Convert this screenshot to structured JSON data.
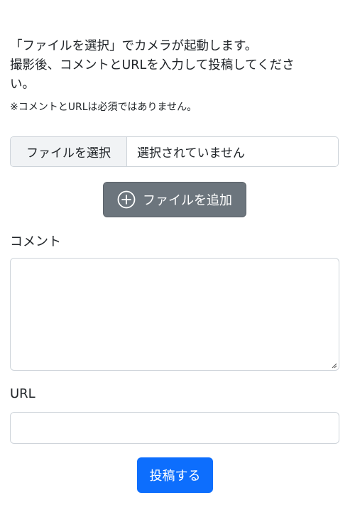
{
  "intro": {
    "line1": "「ファイルを選択」でカメラが起動します。",
    "line2": "撮影後、コメントとURLを入力して投稿してくださ",
    "line3": "い。",
    "note": "※コメントとURLは必須ではありません。"
  },
  "file_input": {
    "button_label": "ファイルを選択",
    "status": "選択されていません"
  },
  "add_file_button": {
    "label": "ファイルを追加",
    "icon": "plus-circle-icon"
  },
  "comment": {
    "label": "コメント",
    "value": ""
  },
  "url": {
    "label": "URL",
    "value": ""
  },
  "submit_button": {
    "label": "投稿する"
  },
  "colors": {
    "secondary": "#6c757d",
    "primary": "#0d6efd",
    "border": "#ced4da"
  }
}
